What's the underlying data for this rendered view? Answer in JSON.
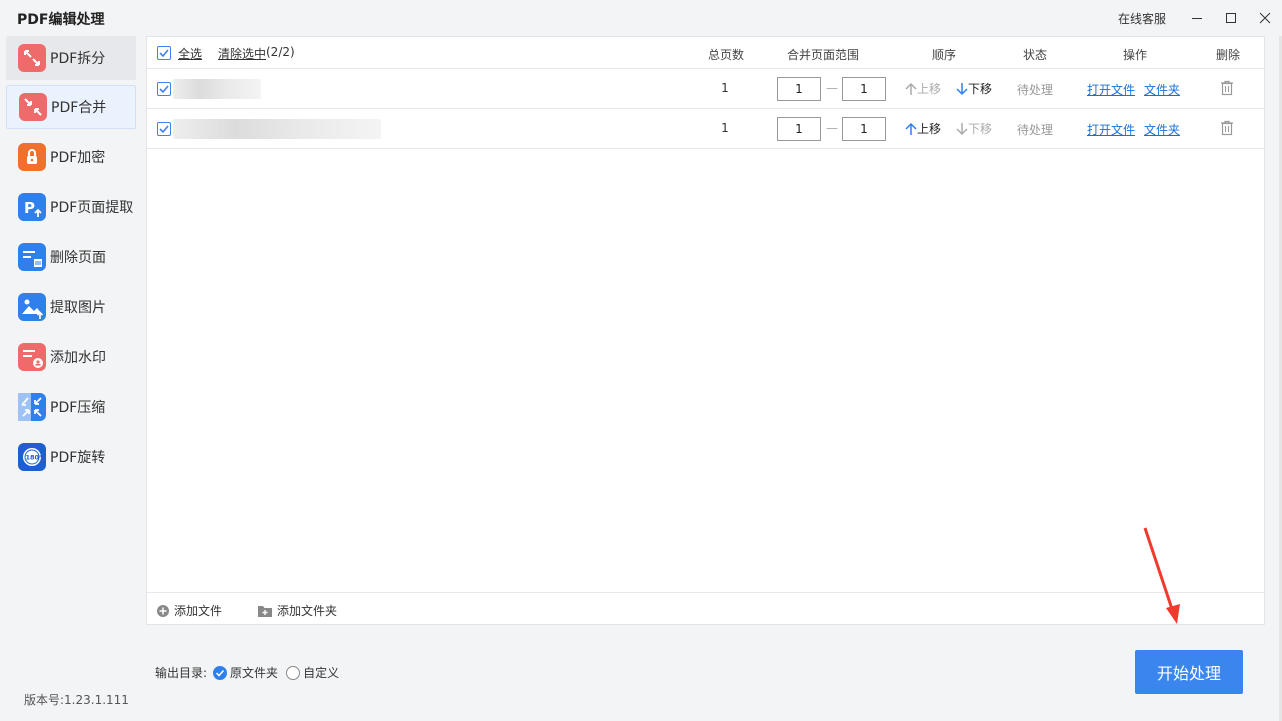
{
  "app": {
    "title": "PDF编辑处理",
    "service": "在线客服"
  },
  "sidebar": {
    "items": [
      {
        "label": "PDF拆分",
        "icon": "split-icon",
        "color": "#e85a5a"
      },
      {
        "label": "PDF合并",
        "icon": "merge-icon",
        "color": "#e85a5a"
      },
      {
        "label": "PDF加密",
        "icon": "lock-icon",
        "color": "#f0702e"
      },
      {
        "label": "PDF页面提取",
        "icon": "page-extract-icon",
        "color": "#2f80ed"
      },
      {
        "label": "删除页面",
        "icon": "delete-page-icon",
        "color": "#2f80ed"
      },
      {
        "label": "提取图片",
        "icon": "image-extract-icon",
        "color": "#2f80ed"
      },
      {
        "label": "添加水印",
        "icon": "watermark-icon",
        "color": "#e85a5a"
      },
      {
        "label": "PDF压缩",
        "icon": "compress-icon",
        "color": "#2f80ed"
      },
      {
        "label": "PDF旋转",
        "icon": "rotate-icon",
        "color": "#1e5fd0"
      }
    ],
    "version": "版本号:1.23.1.111"
  },
  "table": {
    "select_all": "全选",
    "clear_selected": "清除选中",
    "selected_count": "(2/2)",
    "headers": {
      "pages": "总页数",
      "range": "合并页面范围",
      "order": "顺序",
      "status": "状态",
      "action": "操作",
      "delete": "删除"
    },
    "rows": [
      {
        "pages": "1",
        "from": "1",
        "to": "1",
        "up": "上移",
        "down": "下移",
        "status": "待处理",
        "open_file": "打开文件",
        "open_folder": "文件夹"
      },
      {
        "pages": "1",
        "from": "1",
        "to": "1",
        "up": "上移",
        "down": "下移",
        "status": "待处理",
        "open_file": "打开文件",
        "open_folder": "文件夹"
      }
    ],
    "add_file": "添加文件",
    "add_folder": "添加文件夹"
  },
  "output": {
    "label": "输出目录:",
    "option_original": "原文件夹",
    "option_custom": "自定义",
    "selected": "原文件夹"
  },
  "start_button": "开始处理",
  "colors": {
    "accent": "#3a86ee",
    "link": "#1a6fd6"
  }
}
